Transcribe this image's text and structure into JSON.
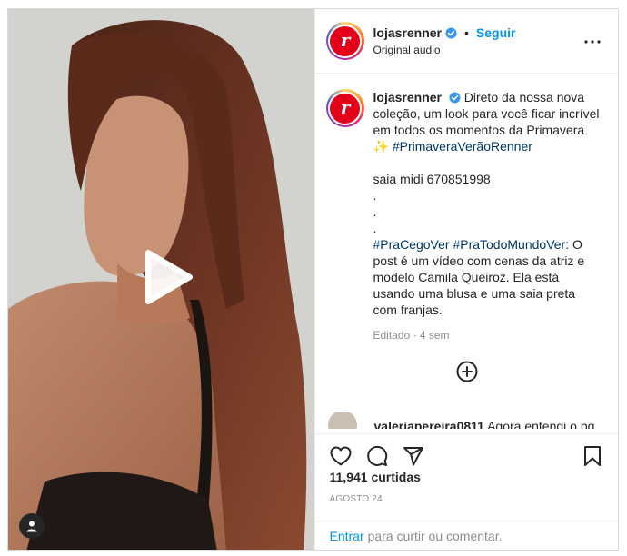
{
  "post": {
    "username": "lojasrenner",
    "follow_label": "Seguir",
    "dot": "•",
    "subtitle": "Original audio",
    "more_label": "•••"
  },
  "caption": {
    "username": "lojasrenner",
    "text_1": "Direto da nossa nova coleção, um look para você ficar incrível em todos os momentos da Primavera ✨",
    "hashtag_1": "#PrimaveraVerãoRenner",
    "text_2": "saia midi 670851998",
    "dots": [
      ".",
      ".",
      "."
    ],
    "hashtag_2": "#PraCegoVer",
    "hashtag_3": "#PraTodoMundoVer",
    "text_3": ": O post é um vídeo com cenas da atriz e modelo Camila Queiroz. Ela está usando uma blusa e uma saia preta com franjas.",
    "meta": "Editado · 4 sem"
  },
  "comment": {
    "username": "valeriapereira0811",
    "text": "Agora entendi o pq"
  },
  "stats": {
    "likes": "11,941 curtidas",
    "date": "AGOSTO 24"
  },
  "login": {
    "link": "Entrar",
    "text": "para curtir ou comentar."
  },
  "colors": {
    "accent": "#0095f6",
    "hashtag": "#00376b",
    "brand": "#e3001b",
    "muted": "#8e8e8e"
  },
  "icons": [
    "play-icon",
    "account-icon",
    "verified-badge-icon",
    "more-options-icon",
    "add-circle-icon",
    "heart-icon",
    "comment-icon",
    "share-icon",
    "bookmark-icon"
  ]
}
